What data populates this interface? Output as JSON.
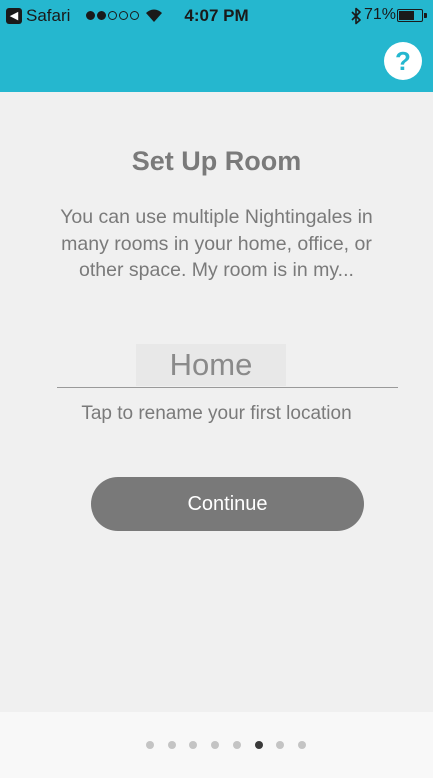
{
  "status_bar": {
    "back_app": "Safari",
    "back_glyph": "◀",
    "signal_bars_filled": 2,
    "signal_bars_total": 5,
    "time": "4:07 PM",
    "battery_percent": "71%",
    "battery_level": 0.71
  },
  "header": {
    "help_label": "?",
    "color": "#25b7cf"
  },
  "main": {
    "title": "Set Up Room",
    "description": "You can use multiple Nightingales in many rooms in your home, office, or other space. My room is in my...",
    "room_input_value": "Home",
    "hint": "Tap to rename your first location",
    "continue_label": "Continue"
  },
  "pager": {
    "total": 8,
    "active_index": 5
  },
  "colors": {
    "accent": "#25b7cf",
    "button": "#797979",
    "text": "#7a7a7a"
  }
}
